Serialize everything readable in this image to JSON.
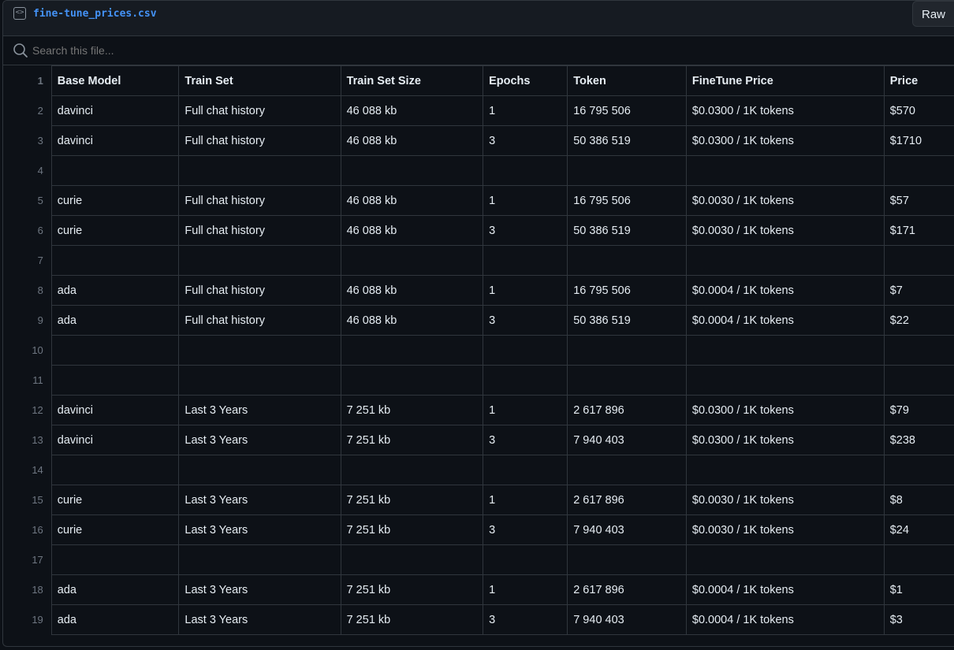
{
  "file": {
    "name": "fine-tune_prices.csv",
    "raw_label": "Raw",
    "icon": "code-file-icon"
  },
  "search": {
    "placeholder": "Search this file..."
  },
  "table": {
    "headers": [
      "Base Model",
      "Train Set",
      "Train Set Size",
      "Epochs",
      "Token",
      "FineTune Price",
      "Price"
    ],
    "rows": [
      [
        "davinci",
        "Full chat history",
        "46 088 kb",
        "1",
        "16 795 506",
        "$0.0300 / 1K tokens",
        "$570"
      ],
      [
        "davinci",
        "Full chat history",
        "46 088 kb",
        "3",
        "50 386 519",
        "$0.0300 / 1K tokens",
        "$1710"
      ],
      [
        "",
        "",
        "",
        "",
        "",
        "",
        ""
      ],
      [
        "curie",
        "Full chat history",
        "46 088 kb",
        "1",
        "16 795 506",
        "$0.0030 / 1K tokens",
        "$57"
      ],
      [
        "curie",
        "Full chat history",
        "46 088 kb",
        "3",
        "50 386 519",
        "$0.0030 / 1K tokens",
        "$171"
      ],
      [
        "",
        "",
        "",
        "",
        "",
        "",
        ""
      ],
      [
        "ada",
        "Full chat history",
        "46 088 kb",
        "1",
        "16 795 506",
        "$0.0004 / 1K tokens",
        "$7"
      ],
      [
        "ada",
        "Full chat history",
        "46 088 kb",
        "3",
        "50 386 519",
        "$0.0004 / 1K tokens",
        "$22"
      ],
      [
        "",
        "",
        "",
        "",
        "",
        "",
        ""
      ],
      [
        "",
        "",
        "",
        "",
        "",
        "",
        ""
      ],
      [
        "davinci",
        "Last 3 Years",
        "7 251 kb",
        "1",
        "2 617 896",
        "$0.0300 / 1K tokens",
        "$79"
      ],
      [
        "davinci",
        "Last 3 Years",
        "7 251 kb",
        "3",
        "7 940 403",
        "$0.0300 / 1K tokens",
        "$238"
      ],
      [
        "",
        "",
        "",
        "",
        "",
        "",
        ""
      ],
      [
        "curie",
        "Last 3 Years",
        "7 251 kb",
        "1",
        "2 617 896",
        "$0.0030 / 1K tokens",
        "$8"
      ],
      [
        "curie",
        "Last 3 Years",
        "7 251 kb",
        "3",
        "7 940 403",
        "$0.0030 / 1K tokens",
        "$24"
      ],
      [
        "",
        "",
        "",
        "",
        "",
        "",
        ""
      ],
      [
        "ada",
        "Last 3 Years",
        "7 251 kb",
        "1",
        "2 617 896",
        "$0.0004 / 1K tokens",
        "$1"
      ],
      [
        "ada",
        "Last 3 Years",
        "7 251 kb",
        "3",
        "7 940 403",
        "$0.0004 / 1K tokens",
        "$3"
      ]
    ]
  }
}
